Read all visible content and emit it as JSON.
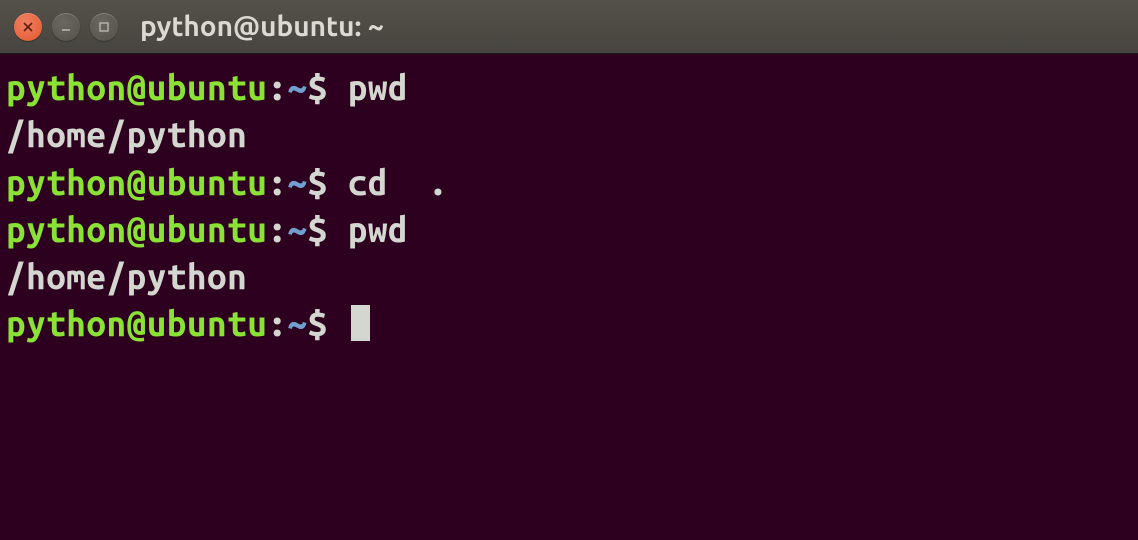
{
  "window": {
    "title": "python@ubuntu: ~"
  },
  "prompt": {
    "user_host": "python@ubuntu",
    "separator": ":",
    "path": "~",
    "symbol": "$"
  },
  "lines": [
    {
      "type": "prompt",
      "command": "pwd"
    },
    {
      "type": "output",
      "text": "/home/python"
    },
    {
      "type": "prompt",
      "command": "cd  ."
    },
    {
      "type": "prompt",
      "command": "pwd"
    },
    {
      "type": "output",
      "text": "/home/python"
    },
    {
      "type": "prompt",
      "command": "",
      "cursor": true
    }
  ],
  "colors": {
    "background": "#2c001e",
    "user_host": "#8ae234",
    "path": "#729fcf",
    "text": "#d3d7cf",
    "close_btn": "#e2582f"
  }
}
